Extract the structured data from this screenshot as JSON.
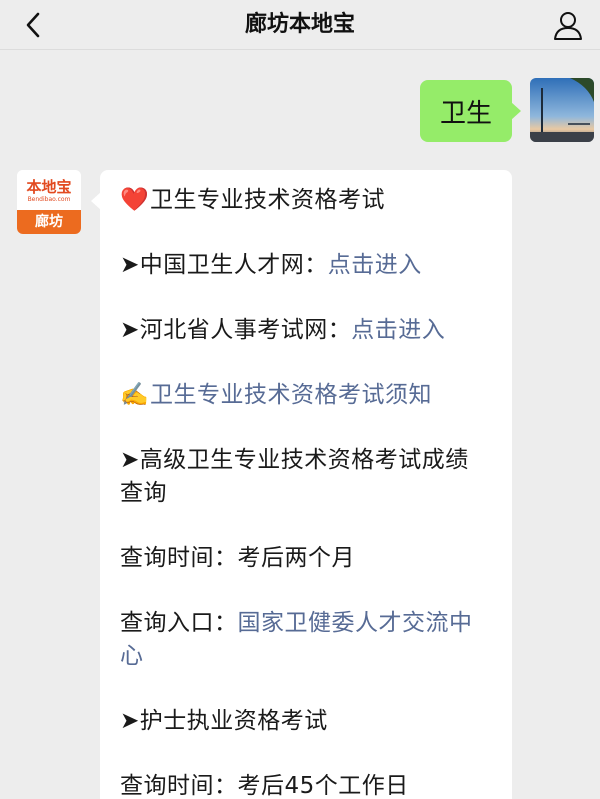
{
  "header": {
    "title": "廊坊本地宝",
    "back_icon": "chevron-left-icon",
    "profile_icon": "user-icon"
  },
  "outgoing": {
    "text": "卫生"
  },
  "bot": {
    "avatar": {
      "brand": "本地宝",
      "sub": "Bendibao.com",
      "city": "廊坊"
    },
    "lines": {
      "l1": {
        "emoji": "❤️",
        "text": "卫生专业技术资格考试"
      },
      "l2": {
        "prefix": "➤中国卫生人才网：",
        "link": "点击进入"
      },
      "l3": {
        "prefix": "➤河北省人事考试网：",
        "link": "点击进入"
      },
      "l4": {
        "emoji": "✍️",
        "link": "卫生专业技术资格考试须知"
      },
      "l5": {
        "text": "➤高级卫生专业技术资格考试成绩查询"
      },
      "l6": {
        "text": "查询时间：考后两个月"
      },
      "l7": {
        "prefix": "查询入口：",
        "link": "国家卫健委人才交流中心"
      },
      "l8": {
        "text": "➤护士执业资格考试"
      },
      "l9": {
        "text": "查询时间：考后45个工作日"
      }
    }
  },
  "colors": {
    "background": "#ededed",
    "outgoing_bubble": "#95ec69",
    "link": "#576b95",
    "brand_orange": "#ec6b1f"
  }
}
